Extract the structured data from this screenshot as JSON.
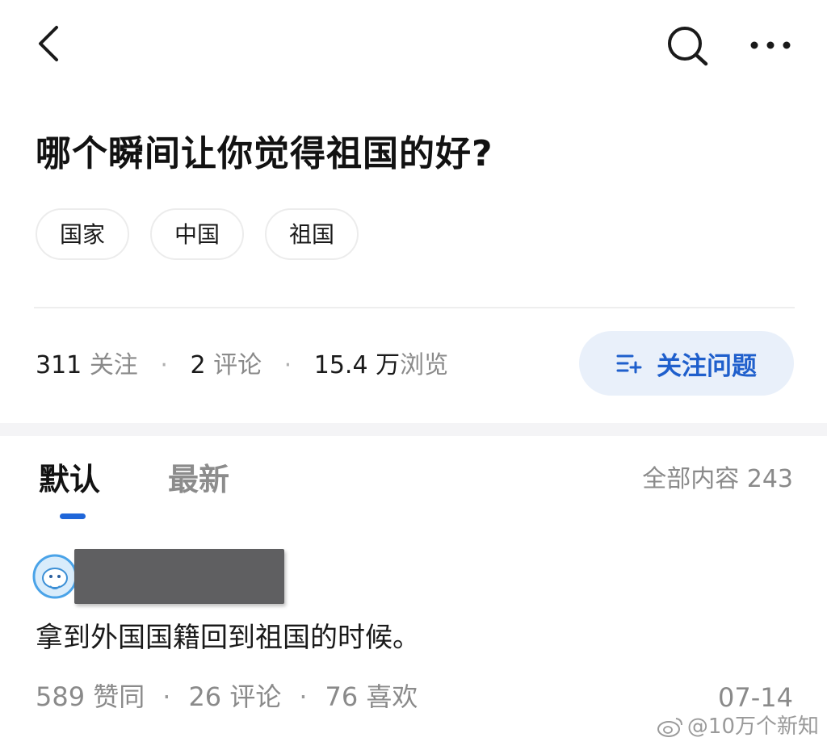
{
  "nav": {
    "back_icon": "chevron-left-icon",
    "search_icon": "search-icon",
    "more_icon": "more-dots-icon"
  },
  "question": {
    "title": "哪个瞬间让你觉得祖国的好?"
  },
  "tags": [
    "国家",
    "中国",
    "祖国"
  ],
  "stats": {
    "followers_num": "311",
    "followers_label": "关注",
    "comments_num": "2",
    "comments_label": "评论",
    "views_num": "15.4 万",
    "views_label": "浏览",
    "separator": "·"
  },
  "follow_button": {
    "label": "关注问题",
    "icon": "follow-list-plus-icon",
    "color": "#1f5fcc",
    "bg": "#e9f0fa"
  },
  "tabs": {
    "default": "默认",
    "newest": "最新",
    "all_content": "全部内容 243"
  },
  "answer": {
    "text": "拿到外国国籍回到祖国的时候。",
    "upvotes": "589 赞同",
    "comments": "26 评论",
    "likes": "76 喜欢",
    "date": "07-14",
    "separator": "·"
  },
  "watermark": {
    "text": "@10万个新知",
    "icon": "weibo-icon"
  },
  "colors": {
    "accent": "#1f66d9",
    "muted": "#8a8a8a",
    "text": "#1a1a1a"
  }
}
